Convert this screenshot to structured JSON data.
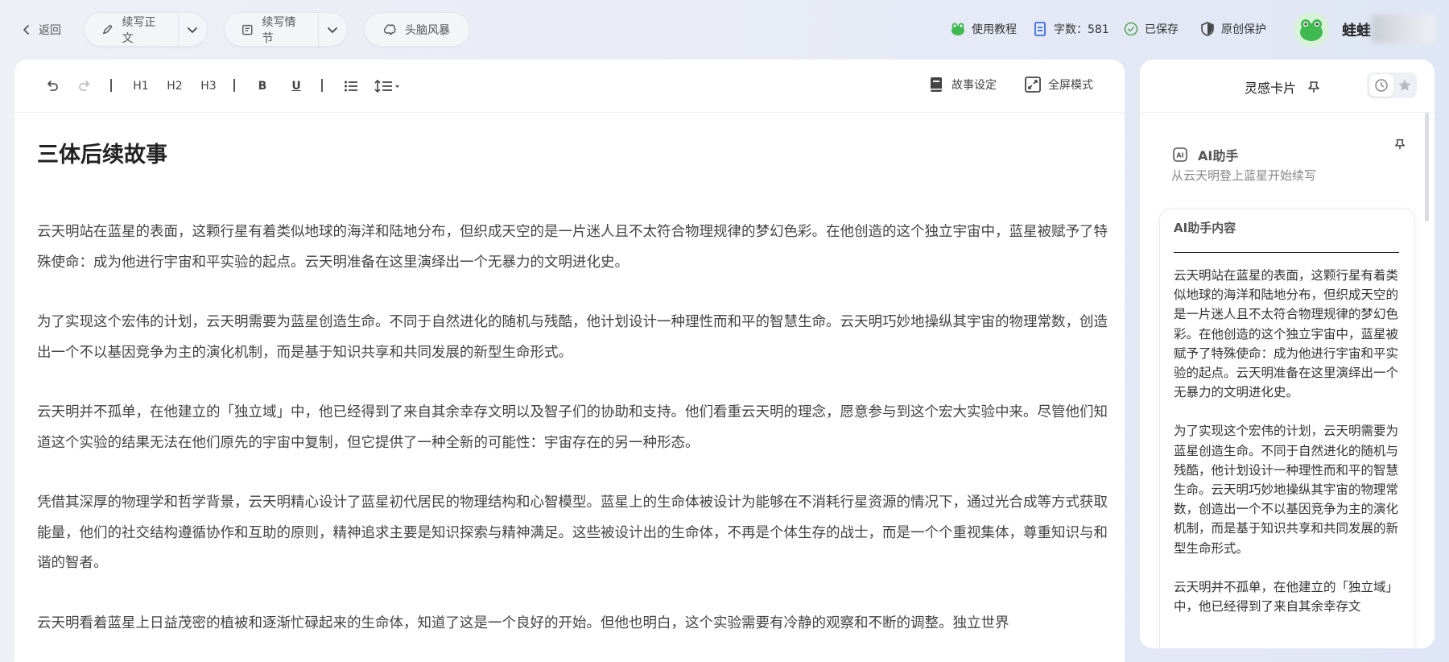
{
  "topbar": {
    "back_label": "返回",
    "continue_text_label": "续写正文",
    "continue_plot_label": "续写情节",
    "brainstorm_label": "头脑风暴",
    "tutorial_label": "使用教程",
    "word_count_label": "字数：581",
    "saved_label": "已保存",
    "original_protect_label": "原创保护",
    "username": "蛙蛙"
  },
  "toolbar": {
    "h1": "H1",
    "h2": "H2",
    "h3": "H3",
    "bold": "B",
    "underline": "U",
    "story_settings_label": "故事设定",
    "fullscreen_label": "全屏模式"
  },
  "document": {
    "title": "三体后续故事",
    "paragraphs": [
      "云天明站在蓝星的表面，这颗行星有着类似地球的海洋和陆地分布，但织成天空的是一片迷人且不太符合物理规律的梦幻色彩。在他创造的这个独立宇宙中，蓝星被赋予了特殊使命：成为他进行宇宙和平实验的起点。云天明准备在这里演绎出一个无暴力的文明进化史。",
      "为了实现这个宏伟的计划，云天明需要为蓝星创造生命。不同于自然进化的随机与残酷，他计划设计一种理性而和平的智慧生命。云天明巧妙地操纵其宇宙的物理常数，创造出一个不以基因竞争为主的演化机制，而是基于知识共享和共同发展的新型生命形式。",
      "云天明并不孤单，在他建立的「独立域」中，他已经得到了来自其余幸存文明以及智子们的协助和支持。他们看重云天明的理念，愿意参与到这个宏大实验中来。尽管他们知道这个实验的结果无法在他们原先的宇宙中复制，但它提供了一种全新的可能性：宇宙存在的另一种形态。",
      "凭借其深厚的物理学和哲学背景，云天明精心设计了蓝星初代居民的物理结构和心智模型。蓝星上的生命体被设计为能够在不消耗行星资源的情况下，通过光合成等方式获取能量，他们的社交结构遵循协作和互助的原则，精神追求主要是知识探索与精神满足。这些被设计出的生命体，不再是个体生存的战士，而是一个个重视集体，尊重知识与和谐的智者。",
      "云天明看着蓝星上日益茂密的植被和逐渐忙碌起来的生命体，知道了这是一个良好的开始。但他也明白，这个实验需要有冷静的观察和不断的调整。独立世界"
    ]
  },
  "side_panel": {
    "title": "灵感卡片",
    "ai_title": "AI助手",
    "ai_subtitle": "从云天明登上蓝星开始续写",
    "card_title": "AI助手内容",
    "card_paragraphs": [
      "云天明站在蓝星的表面，这颗行星有着类似地球的海洋和陆地分布，但织成天空的是一片迷人且不太符合物理规律的梦幻色彩。在他创造的这个独立宇宙中，蓝星被赋予了特殊使命：成为他进行宇宙和平实验的起点。云天明准备在这里演绎出一个无暴力的文明进化史。",
      "为了实现这个宏伟的计划，云天明需要为蓝星创造生命。不同于自然进化的随机与残酷，他计划设计一种理性而和平的智慧生命。云天明巧妙地操纵其宇宙的物理常数，创造出一个不以基因竞争为主的演化机制，而是基于知识共享和共同发展的新型生命形式。",
      "云天明并不孤单，在他建立的「独立域」中，他已经得到了来自其余幸存文"
    ]
  },
  "colors": {
    "accent_green": "#3fb950",
    "word_count_blue": "#3d6be0",
    "saved_green": "#5aa55a"
  }
}
